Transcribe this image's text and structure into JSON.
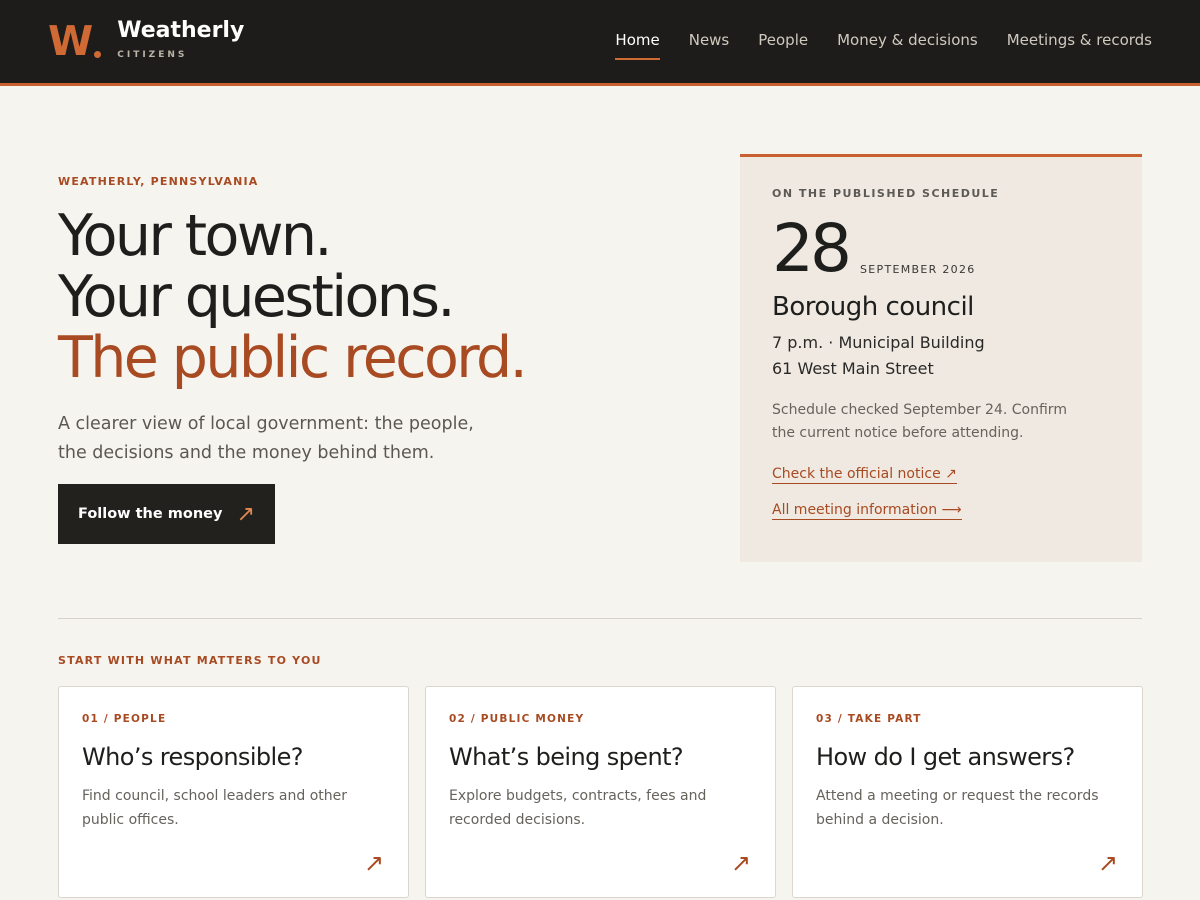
{
  "header": {
    "logo_mark": "W",
    "brand_name": "Weatherly",
    "brand_sub": "CITIZENS",
    "nav": [
      {
        "label": "Home",
        "active": true
      },
      {
        "label": "News"
      },
      {
        "label": "People"
      },
      {
        "label": "Money & decisions"
      },
      {
        "label": "Meetings & records"
      }
    ]
  },
  "hero": {
    "eyebrow": "WEATHERLY, PENNSYLVANIA",
    "title_lines": [
      "Your town.",
      "Your questions.",
      "The public record."
    ],
    "lead": "A clearer view of local government: the people, the decisions and the money behind them.",
    "cta_label": "Follow the money",
    "cta_icon": "arrow-up-right-icon"
  },
  "schedule": {
    "eyebrow": "ON THE PUBLISHED SCHEDULE",
    "day": "28",
    "month_year": "SEPTEMBER 2026",
    "title": "Borough council",
    "time_place": "7 p.m. · Municipal Building",
    "address": "61 West Main Street",
    "note": "Schedule checked September 24. Confirm the current notice before attending.",
    "link_notice": "Check the official notice ↗",
    "link_all": "All meeting information ⟶"
  },
  "section": {
    "eyebrow": "START WITH WHAT MATTERS TO YOU",
    "cards": [
      {
        "eyebrow": "01 / PEOPLE",
        "title": "Who’s responsible?",
        "text": "Find council, school leaders and other public offices."
      },
      {
        "eyebrow": "02 / PUBLIC MONEY",
        "title": "What’s being spent?",
        "text": "Explore budgets, contracts, fees and recorded decisions."
      },
      {
        "eyebrow": "03 / TAKE PART",
        "title": "How do I get answers?",
        "text": "Attend a meeting or request the records behind a decision."
      }
    ]
  },
  "colors": {
    "accent": "#c8602f",
    "accent_dark": "#a84a22",
    "header_bg": "#1d1c1a",
    "page_bg": "#f6f4ef",
    "card_bg": "#efe9e1"
  }
}
